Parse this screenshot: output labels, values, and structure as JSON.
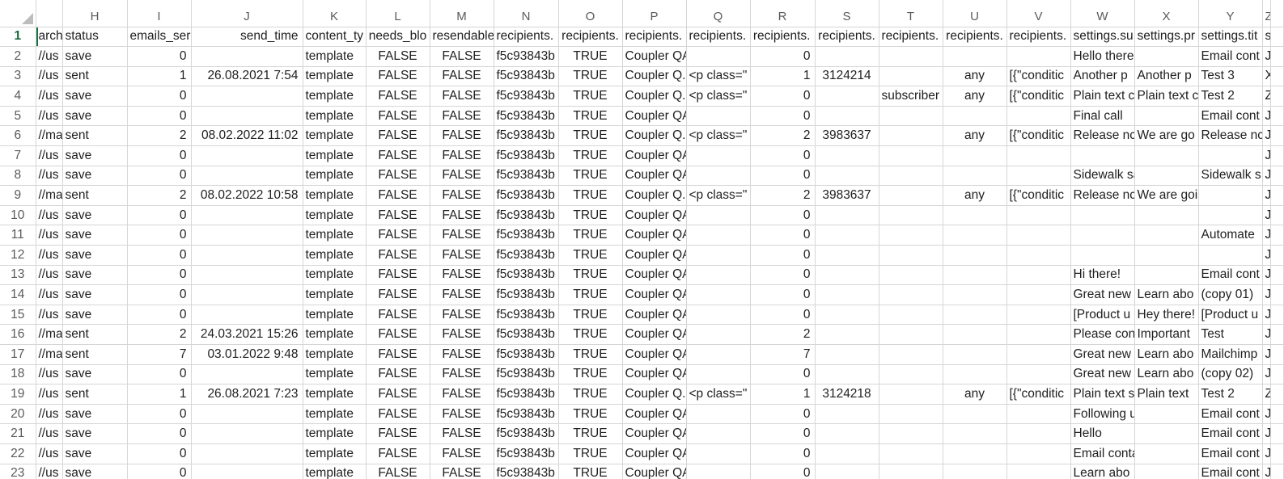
{
  "app": {
    "name": "Spreadsheet"
  },
  "grid": {
    "columns": [
      "",
      "H",
      "I",
      "J",
      "K",
      "L",
      "M",
      "N",
      "O",
      "P",
      "Q",
      "R",
      "S",
      "T",
      "U",
      "V",
      "W",
      "X",
      "Y",
      "Z"
    ],
    "row_numbers": [
      "1",
      "2",
      "3",
      "4",
      "5",
      "6",
      "7",
      "8",
      "9",
      "10",
      "11",
      "12",
      "13",
      "14",
      "15",
      "16",
      "17",
      "18",
      "19",
      "20",
      "21",
      "22",
      "23"
    ],
    "alignments": [
      "l",
      "l",
      "r",
      "r",
      "l",
      "c",
      "c",
      "l",
      "c",
      "l",
      "l",
      "r",
      "c",
      "l",
      "c",
      "l",
      "l",
      "l",
      "l",
      "l"
    ],
    "rows": [
      [
        "archi",
        "status",
        "emails_ser",
        "send_time",
        "content_ty",
        "needs_blo",
        "resendable",
        "recipients.",
        "recipients.",
        "recipients.",
        "recipients.",
        "recipients.",
        "recipients.",
        "recipients.",
        "recipients.",
        "recipients.",
        "settings.su",
        "settings.pr",
        "settings.tit",
        "s"
      ],
      [
        "//us",
        "save",
        "0",
        "",
        "template",
        "FALSE",
        "FALSE",
        "f5c93843b",
        "TRUE",
        "Coupler QA",
        "",
        "0",
        "",
        "",
        "",
        "",
        "Hello there?",
        "",
        "Email cont",
        "J"
      ],
      [
        "//us",
        "sent",
        "1",
        "26.08.2021 7:54",
        "template",
        "FALSE",
        "FALSE",
        "f5c93843b",
        "TRUE",
        "Coupler Q.",
        "<p class=\"",
        "1",
        "3124214",
        "",
        "any",
        "[{\"conditic",
        "Another p",
        "Another p",
        "Test 3",
        "X"
      ],
      [
        "//us",
        "save",
        "0",
        "",
        "template",
        "FALSE",
        "FALSE",
        "f5c93843b",
        "TRUE",
        "Coupler Q.",
        "<p class=\"",
        "0",
        "",
        "subscriber",
        "any",
        "[{\"conditic",
        "Plain text c",
        "Plain text c",
        "Test 2",
        "Z"
      ],
      [
        "//us",
        "save",
        "0",
        "",
        "template",
        "FALSE",
        "FALSE",
        "f5c93843b",
        "TRUE",
        "Coupler QA",
        "",
        "0",
        "",
        "",
        "",
        "",
        "Final call",
        "",
        "Email cont",
        "J"
      ],
      [
        "//ma",
        "sent",
        "2",
        "08.02.2022 11:02",
        "template",
        "FALSE",
        "FALSE",
        "f5c93843b",
        "TRUE",
        "Coupler Q.",
        "<p class=\"",
        "2",
        "3983637",
        "",
        "any",
        "[{\"conditic",
        "Release nc",
        "We are go",
        "Release nc",
        "J"
      ],
      [
        "//us",
        "save",
        "0",
        "",
        "template",
        "FALSE",
        "FALSE",
        "f5c93843b",
        "TRUE",
        "Coupler QA",
        "",
        "0",
        "",
        "",
        "",
        "",
        "",
        "",
        "",
        "J"
      ],
      [
        "//us",
        "save",
        "0",
        "",
        "template",
        "FALSE",
        "FALSE",
        "f5c93843b",
        "TRUE",
        "Coupler QA",
        "",
        "0",
        "",
        "",
        "",
        "",
        "Sidewalk sale - join us",
        "",
        "Sidewalk s",
        "J"
      ],
      [
        "//ma",
        "sent",
        "2",
        "08.02.2022 10:58",
        "template",
        "FALSE",
        "FALSE",
        "f5c93843b",
        "TRUE",
        "Coupler Q.",
        "<p class=\"",
        "2",
        "3983637",
        "",
        "any",
        "[{\"conditic",
        "Release nc",
        "We are going to relea",
        "",
        "J"
      ],
      [
        "//us",
        "save",
        "0",
        "",
        "template",
        "FALSE",
        "FALSE",
        "f5c93843b",
        "TRUE",
        "Coupler QA",
        "",
        "0",
        "",
        "",
        "",
        "",
        "",
        "",
        "",
        "J"
      ],
      [
        "//us",
        "save",
        "0",
        "",
        "template",
        "FALSE",
        "FALSE",
        "f5c93843b",
        "TRUE",
        "Coupler QA",
        "",
        "0",
        "",
        "",
        "",
        "",
        "",
        "",
        "Automate",
        "J"
      ],
      [
        "//us",
        "save",
        "0",
        "",
        "template",
        "FALSE",
        "FALSE",
        "f5c93843b",
        "TRUE",
        "Coupler QA",
        "",
        "0",
        "",
        "",
        "",
        "",
        "",
        "",
        "",
        "J"
      ],
      [
        "//us",
        "save",
        "0",
        "",
        "template",
        "FALSE",
        "FALSE",
        "f5c93843b",
        "TRUE",
        "Coupler QA",
        "",
        "0",
        "",
        "",
        "",
        "",
        "Hi there!",
        "",
        "Email cont",
        "J"
      ],
      [
        "//us",
        "save",
        "0",
        "",
        "template",
        "FALSE",
        "FALSE",
        "f5c93843b",
        "TRUE",
        "Coupler QA",
        "",
        "0",
        "",
        "",
        "",
        "",
        "Great new",
        "Learn abo",
        "(copy 01)",
        "J"
      ],
      [
        "//us",
        "save",
        "0",
        "",
        "template",
        "FALSE",
        "FALSE",
        "f5c93843b",
        "TRUE",
        "Coupler QA",
        "",
        "0",
        "",
        "",
        "",
        "",
        "[Product u",
        "Hey there!",
        "[Product u",
        "J"
      ],
      [
        "//ma",
        "sent",
        "2",
        "24.03.2021 15:26",
        "template",
        "FALSE",
        "FALSE",
        "f5c93843b",
        "TRUE",
        "Coupler QA",
        "",
        "2",
        "",
        "",
        "",
        "",
        "Please con",
        "Important",
        "Test",
        "J"
      ],
      [
        "//ma",
        "sent",
        "7",
        "03.01.2022 9:48",
        "template",
        "FALSE",
        "FALSE",
        "f5c93843b",
        "TRUE",
        "Coupler QA",
        "",
        "7",
        "",
        "",
        "",
        "",
        "Great new",
        "Learn abo",
        "Mailchimp",
        "J"
      ],
      [
        "//us",
        "save",
        "0",
        "",
        "template",
        "FALSE",
        "FALSE",
        "f5c93843b",
        "TRUE",
        "Coupler QA",
        "",
        "0",
        "",
        "",
        "",
        "",
        "Great new",
        "Learn abo",
        "(copy 02)",
        "J"
      ],
      [
        "//us",
        "sent",
        "1",
        "26.08.2021 7:23",
        "template",
        "FALSE",
        "FALSE",
        "f5c93843b",
        "TRUE",
        "Coupler Q.",
        "<p class=\"",
        "1",
        "3124218",
        "",
        "any",
        "[{\"conditic",
        "Plain text s",
        "Plain text",
        "Test 2",
        "Z"
      ],
      [
        "//us",
        "save",
        "0",
        "",
        "template",
        "FALSE",
        "FALSE",
        "f5c93843b",
        "TRUE",
        "Coupler QA",
        "",
        "0",
        "",
        "",
        "",
        "",
        "Following up!",
        "",
        "Email cont",
        "J"
      ],
      [
        "//us",
        "save",
        "0",
        "",
        "template",
        "FALSE",
        "FALSE",
        "f5c93843b",
        "TRUE",
        "Coupler QA",
        "",
        "0",
        "",
        "",
        "",
        "",
        "Hello",
        "",
        "Email cont",
        "J"
      ],
      [
        "//us",
        "save",
        "0",
        "",
        "template",
        "FALSE",
        "FALSE",
        "f5c93843b",
        "TRUE",
        "Coupler QA",
        "",
        "0",
        "",
        "",
        "",
        "",
        "Email contacts",
        "",
        "Email cont",
        "J"
      ],
      [
        "//us",
        "save",
        "0",
        "",
        "template",
        "FALSE",
        "FALSE",
        "f5c93843b",
        "TRUE",
        "Coupler QA",
        "",
        "0",
        "",
        "",
        "",
        "",
        "Learn abo",
        "",
        "Email cont",
        "J"
      ]
    ]
  },
  "colors": {
    "header_text": "#5a5a5a",
    "gridline": "#d6d6d6",
    "active_row": "#1a6b3c"
  }
}
